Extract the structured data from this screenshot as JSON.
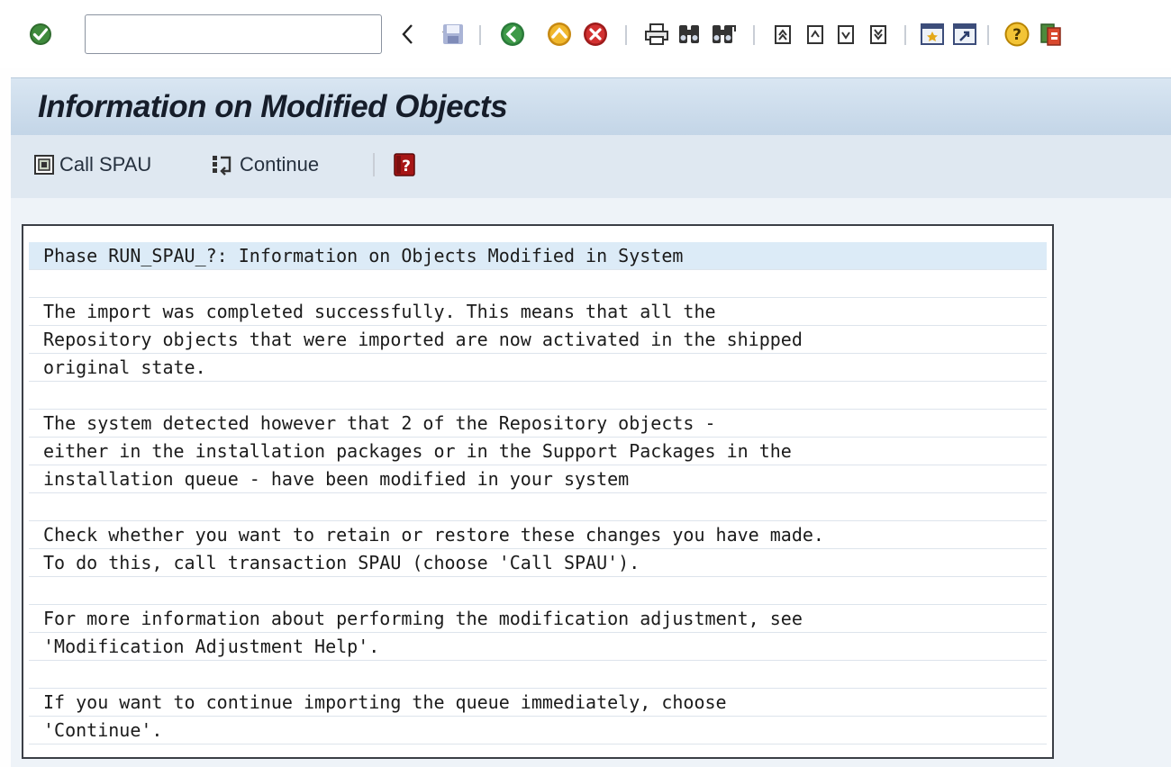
{
  "toolbar": {
    "command_field": {
      "value": "",
      "placeholder": ""
    },
    "icons": [
      "enter-icon",
      "back-icon",
      "exit-icon",
      "cancel-icon",
      "print-icon",
      "find-icon",
      "find-next-icon",
      "first-page-icon",
      "previous-page-icon",
      "next-page-icon",
      "last-page-icon",
      "new-session-icon",
      "shortcut-icon",
      "help-icon",
      "customize-layout-icon"
    ]
  },
  "title": "Information on Modified Objects",
  "app_toolbar": {
    "call_spau_label": "Call SPAU",
    "continue_label": "Continue"
  },
  "message": {
    "lines": [
      "Phase RUN_SPAU_?: Information on Objects Modified in System",
      "",
      "The import was completed successfully. This means that all the",
      "Repository objects that were imported are now activated in the shipped",
      "original state.",
      "",
      "The system detected however that 2 of the Repository objects -",
      "either in the installation packages or in the Support Packages in the",
      "installation queue - have been modified in your system",
      "",
      "Check whether you want to retain or restore these changes you have made.",
      "To do this, call transaction SPAU (choose 'Call SPAU').",
      "",
      "For more information about performing the modification adjustment, see",
      "'Modification Adjustment Help'.",
      "",
      "If you want to continue importing the queue immediately, choose",
      "'Continue'."
    ]
  },
  "colors": {
    "title_bar": "#c9d9e9",
    "highlight_line": "#dcebf7",
    "content_background": "#eef3f8"
  }
}
